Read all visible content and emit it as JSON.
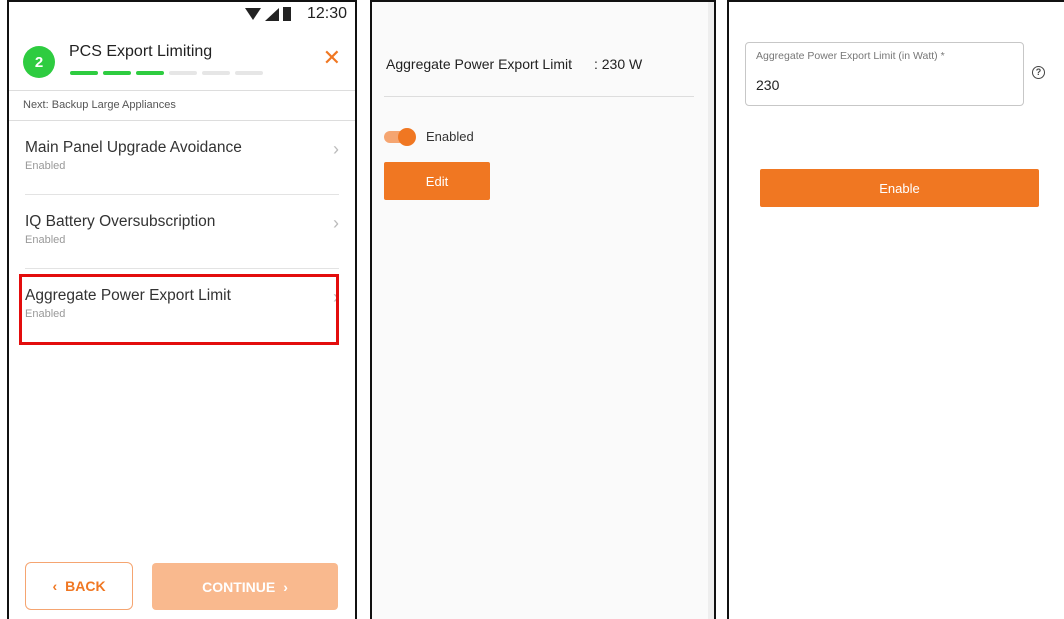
{
  "phone": {
    "status_bar": {
      "time": "12:30"
    },
    "header": {
      "step_number": "2",
      "title": "PCS Export Limiting",
      "progress_total": 6,
      "progress_done": 3
    },
    "next_text": "Next: Backup Large Appliances",
    "menu_items": [
      {
        "title": "Main Panel Upgrade Avoidance",
        "status": "Enabled"
      },
      {
        "title": "IQ Battery Oversubscription",
        "status": "Enabled"
      },
      {
        "title": "Aggregate Power Export Limit",
        "status": "Enabled"
      }
    ],
    "back_label": "BACK",
    "continue_label": "CONTINUE"
  },
  "detail": {
    "limit_label": "Aggregate Power Export Limit",
    "limit_value": ": 230 W",
    "toggle_label": "Enabled",
    "edit_label": "Edit"
  },
  "form": {
    "field_label": "Aggregate Power Export Limit (in Watt) *",
    "field_value": "230",
    "enable_label": "Enable"
  },
  "colors": {
    "accent": "#f07722",
    "accent_light": "#f9b98e",
    "success": "#2ecc40",
    "highlight": "#e30d0d"
  }
}
